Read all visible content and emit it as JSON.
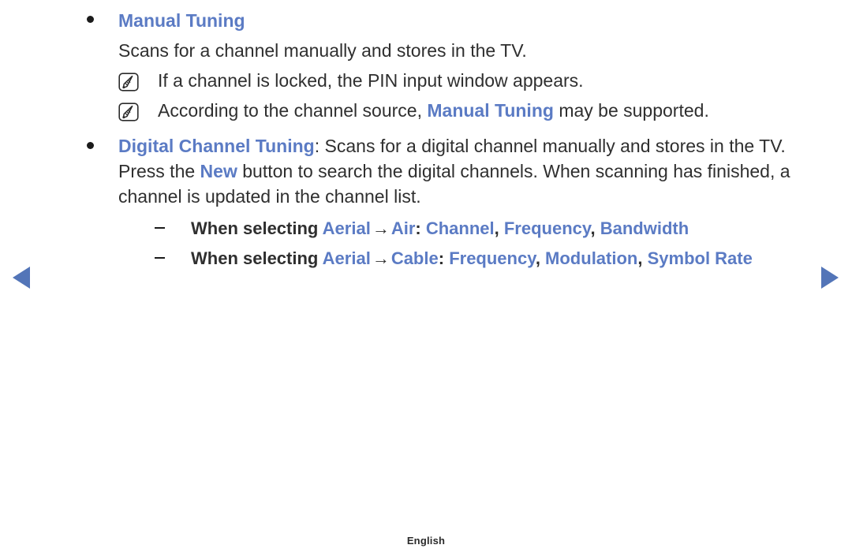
{
  "accent_color": "#5b7bc4",
  "text_color": "#2f2f2f",
  "nav": {
    "prev_label": "previous page",
    "next_label": "next page"
  },
  "section": {
    "bullet_glyph": "●",
    "heading": "Manual Tuning",
    "description": "Scans for a channel manually and stores in the TV.",
    "notes": [
      {
        "icon": "note-pencil-icon",
        "text": "If a channel is locked, the PIN input window appears."
      },
      {
        "icon": "note-pencil-icon",
        "prefix": "According to the channel source, ",
        "term": "Manual Tuning",
        "suffix": " may be supported."
      }
    ]
  },
  "digital_tuning": {
    "term": "Digital Channel Tuning",
    "colon": ":",
    "body_part1": " Scans for a digital channel manually and stores in the TV. Press the ",
    "button_term": "New",
    "body_part2": " button to search the digital channels. When scanning has finished, a channel is updated in the channel list."
  },
  "sub_items": [
    {
      "dash": "–",
      "lead": "When selecting ",
      "source": "Aerial",
      "arrow": "→",
      "mode": "Air",
      "colon": ":",
      "fields": [
        "Channel",
        "Frequency",
        "Bandwidth"
      ],
      "separator": ", "
    },
    {
      "dash": "–",
      "lead": "When selecting ",
      "source": "Aerial",
      "arrow": "→",
      "mode": "Cable",
      "colon": ":",
      "fields": [
        "Frequency",
        "Modulation",
        "Symbol Rate"
      ],
      "separator": ", "
    }
  ],
  "footer": {
    "language": "English"
  }
}
